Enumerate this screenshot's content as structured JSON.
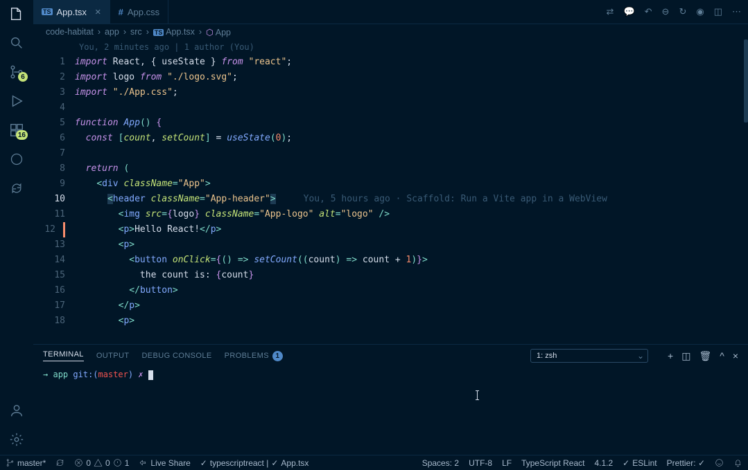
{
  "activitybar": {
    "items": [
      {
        "name": "explorer-icon"
      },
      {
        "name": "search-icon"
      },
      {
        "name": "source-control-icon",
        "badge": "6"
      },
      {
        "name": "run-debug-icon"
      },
      {
        "name": "extensions-icon",
        "badge": "16"
      },
      {
        "name": "remote-icon"
      },
      {
        "name": "sync-icon"
      }
    ],
    "bottom": [
      {
        "name": "accounts-icon"
      },
      {
        "name": "settings-icon"
      }
    ]
  },
  "tabs": [
    {
      "icon": "TS",
      "label": "App.tsx",
      "active": true,
      "close": true
    },
    {
      "icon": "#",
      "label": "App.css",
      "active": false,
      "close": false
    }
  ],
  "tab_actions": [
    "git-compare-icon",
    "comment-icon",
    "undo-icon",
    "step-icon",
    "step-over-icon",
    "circle-icon",
    "split-editor-icon",
    "more-icon"
  ],
  "breadcrumbs": [
    "code-habitat",
    "app",
    "src",
    {
      "icon": "TS",
      "label": "App.tsx"
    },
    {
      "icon": "sym",
      "label": "App"
    }
  ],
  "blame_header": "You, 2 minutes ago | 1 author (You)",
  "inline_blame": "You, 5 hours ago · Scaffold: Run a Vite app in a WebView",
  "active_line": 10,
  "mod_line": 12,
  "code_lines": [
    [
      [
        "kw",
        "import"
      ],
      [
        "sp",
        " "
      ],
      [
        "var",
        "React"
      ],
      [
        "var",
        ", { "
      ],
      [
        "var",
        "useState"
      ],
      [
        "var",
        " } "
      ],
      [
        "kw",
        "from"
      ],
      [
        "sp",
        " "
      ],
      [
        "str",
        "\"react\""
      ],
      [
        "var",
        ";"
      ]
    ],
    [
      [
        "kw",
        "import"
      ],
      [
        "sp",
        " "
      ],
      [
        "var",
        "logo "
      ],
      [
        "kw",
        "from"
      ],
      [
        "sp",
        " "
      ],
      [
        "str",
        "\"./logo.svg\""
      ],
      [
        "var",
        ";"
      ]
    ],
    [
      [
        "kw",
        "import"
      ],
      [
        "sp",
        " "
      ],
      [
        "str",
        "\"./App.css\""
      ],
      [
        "var",
        ";"
      ]
    ],
    [],
    [
      [
        "kw",
        "function"
      ],
      [
        "sp",
        " "
      ],
      [
        "fn",
        "App"
      ],
      [
        "punct",
        "()"
      ],
      [
        "sp",
        " "
      ],
      [
        "brace",
        "{"
      ]
    ],
    [
      [
        "sp",
        "  "
      ],
      [
        "kw",
        "const"
      ],
      [
        "sp",
        " "
      ],
      [
        "punct",
        "["
      ],
      [
        "attr",
        "count"
      ],
      [
        "var",
        ", "
      ],
      [
        "attr",
        "setCount"
      ],
      [
        "punct",
        "]"
      ],
      [
        "sp",
        " = "
      ],
      [
        "fn",
        "useState"
      ],
      [
        "punct",
        "("
      ],
      [
        "num",
        "0"
      ],
      [
        "punct",
        ")"
      ],
      [
        "var",
        ";"
      ]
    ],
    [],
    [
      [
        "sp",
        "  "
      ],
      [
        "kw",
        "return"
      ],
      [
        "sp",
        " "
      ],
      [
        "punct",
        "("
      ]
    ],
    [
      [
        "sp",
        "    "
      ],
      [
        "punct",
        "<"
      ],
      [
        "def",
        "div"
      ],
      [
        "sp",
        " "
      ],
      [
        "attr",
        "className"
      ],
      [
        "punct",
        "="
      ],
      [
        "str",
        "\"App\""
      ],
      [
        "punct",
        ">"
      ]
    ],
    [
      [
        "sp",
        "      "
      ],
      [
        "selopen",
        "<"
      ],
      [
        "def",
        "header"
      ],
      [
        "sp",
        " "
      ],
      [
        "attr",
        "className"
      ],
      [
        "punct",
        "="
      ],
      [
        "str",
        "\"App-header\""
      ],
      [
        "selclose",
        ">"
      ]
    ],
    [
      [
        "sp",
        "        "
      ],
      [
        "punct",
        "<"
      ],
      [
        "def",
        "img"
      ],
      [
        "sp",
        " "
      ],
      [
        "attr",
        "src"
      ],
      [
        "punct",
        "="
      ],
      [
        "brace",
        "{"
      ],
      [
        "var",
        "logo"
      ],
      [
        "brace",
        "}"
      ],
      [
        "sp",
        " "
      ],
      [
        "attr",
        "className"
      ],
      [
        "punct",
        "="
      ],
      [
        "str",
        "\"App-logo\""
      ],
      [
        "sp",
        " "
      ],
      [
        "attr",
        "alt"
      ],
      [
        "punct",
        "="
      ],
      [
        "str",
        "\"logo\""
      ],
      [
        "sp",
        " "
      ],
      [
        "punct",
        "/>"
      ]
    ],
    [
      [
        "sp",
        "        "
      ],
      [
        "punct",
        "<"
      ],
      [
        "def",
        "p"
      ],
      [
        "punct",
        ">"
      ],
      [
        "var",
        "Hello React!"
      ],
      [
        "punct",
        "</"
      ],
      [
        "def",
        "p"
      ],
      [
        "punct",
        ">"
      ]
    ],
    [
      [
        "sp",
        "        "
      ],
      [
        "punct",
        "<"
      ],
      [
        "def",
        "p"
      ],
      [
        "punct",
        ">"
      ]
    ],
    [
      [
        "sp",
        "          "
      ],
      [
        "punct",
        "<"
      ],
      [
        "def",
        "button"
      ],
      [
        "sp",
        " "
      ],
      [
        "attr",
        "onClick"
      ],
      [
        "punct",
        "="
      ],
      [
        "brace",
        "{"
      ],
      [
        "punct",
        "()"
      ],
      [
        "sp",
        " "
      ],
      [
        "punct",
        "=>"
      ],
      [
        "sp",
        " "
      ],
      [
        "fn",
        "setCount"
      ],
      [
        "punct",
        "(("
      ],
      [
        "var",
        "count"
      ],
      [
        "punct",
        ")"
      ],
      [
        "sp",
        " "
      ],
      [
        "punct",
        "=>"
      ],
      [
        "sp",
        " "
      ],
      [
        "var",
        "count + "
      ],
      [
        "num",
        "1"
      ],
      [
        "punct",
        ")"
      ],
      [
        "brace",
        "}"
      ],
      [
        "punct",
        ">"
      ]
    ],
    [
      [
        "sp",
        "            "
      ],
      [
        "var",
        "the count is: "
      ],
      [
        "brace",
        "{"
      ],
      [
        "var",
        "count"
      ],
      [
        "brace",
        "}"
      ]
    ],
    [
      [
        "sp",
        "          "
      ],
      [
        "punct",
        "</"
      ],
      [
        "def",
        "button"
      ],
      [
        "punct",
        ">"
      ]
    ],
    [
      [
        "sp",
        "        "
      ],
      [
        "punct",
        "</"
      ],
      [
        "def",
        "p"
      ],
      [
        "punct",
        ">"
      ]
    ],
    [
      [
        "sp",
        "        "
      ],
      [
        "punct",
        "<"
      ],
      [
        "def",
        "p"
      ],
      [
        "punct",
        ">"
      ]
    ]
  ],
  "panel": {
    "tabs": [
      {
        "label": "TERMINAL",
        "active": true
      },
      {
        "label": "OUTPUT"
      },
      {
        "label": "DEBUG CONSOLE"
      },
      {
        "label": "PROBLEMS",
        "badge": "1"
      }
    ],
    "terminal_selector": "1: zsh",
    "prompt": {
      "arrow": "→",
      "path": "app",
      "git_prefix": "git:(",
      "branch": "master",
      "git_suffix": ")",
      "symbol": "✗"
    }
  },
  "status": {
    "branch": "master*",
    "errors": "0",
    "warnings": "0",
    "info": "1",
    "live_share": "Live Share",
    "lang_check": "typescriptreact |",
    "file_check": "App.tsx",
    "spaces": "Spaces: 2",
    "encoding": "UTF-8",
    "eol": "LF",
    "language": "TypeScript React",
    "version": "4.1.2",
    "eslint": "ESLint",
    "prettier": "Prettier: ✓",
    "bell": "bell-icon"
  }
}
